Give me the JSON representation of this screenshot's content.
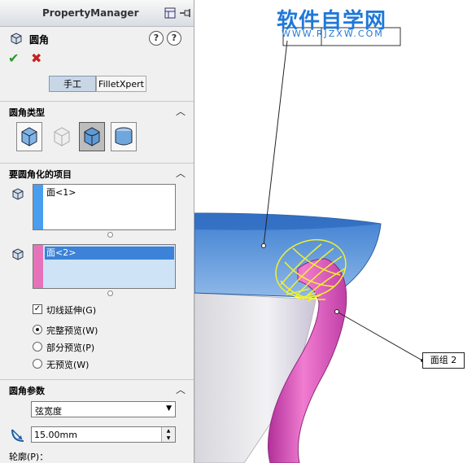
{
  "property_manager": {
    "title": "PropertyManager",
    "feature_name": "圆角",
    "help_icon": "?",
    "tabs": {
      "manual": "手工",
      "filletxpert": "FilletXpert"
    },
    "sections": {
      "fillet_type": "圆角类型",
      "items_to_fillet": "要圆角化的项目",
      "fillet_params": "圆角参数",
      "profile": "轮廓(P)："
    },
    "items_list_1": [
      "面<1>"
    ],
    "items_list_2": [
      "面<2>"
    ],
    "tangent_propagation": {
      "label": "切线延伸(G)",
      "checked": true
    },
    "preview_options": [
      {
        "label": "完整预览(W)",
        "selected": true
      },
      {
        "label": "部分预览(P)",
        "selected": false
      },
      {
        "label": "无预览(W)",
        "selected": false
      }
    ],
    "param_select_value": "弦宽度",
    "width_value": "15.00mm"
  },
  "viewport": {
    "watermark_title": "软件自学网",
    "watermark_url": "WWW.RJZXW.COM",
    "callout_label": "面组 2"
  },
  "colors": {
    "face1_bar": "#4a9ef0",
    "face2_bar": "#e673b9",
    "watermark": "#1f78d8",
    "shell_blue": "#4f8ed8",
    "pipe_pink": "#e055b8",
    "preview_yellow": "#f2f22a"
  }
}
